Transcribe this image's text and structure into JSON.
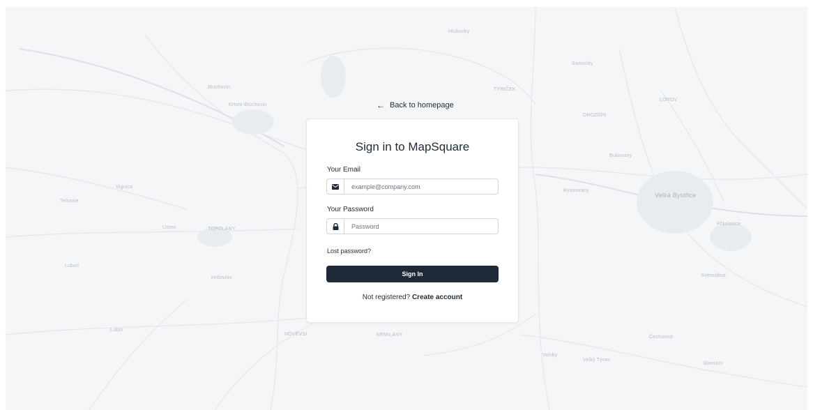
{
  "back_link": {
    "arrow": "←",
    "label": "Back to homepage"
  },
  "card": {
    "title": "Sign in to MapSquare",
    "email": {
      "label": "Your Email",
      "placeholder": "example@company.com",
      "value": ""
    },
    "password": {
      "label": "Your Password",
      "placeholder": "Password",
      "value": ""
    },
    "lost_password": "Lost password?",
    "sign_in_button": "Sign In",
    "register_prompt": "Not registered?",
    "create_account": "Create account"
  },
  "map_labels": [
    "Bluchovin",
    "Krtom-Bluchovin",
    "Vignica",
    "Telsnice",
    "Usten",
    "TOPOLANY",
    "Hrdovitin",
    "Lubolí",
    "Lubín",
    "NOVÉVSI",
    "NEMILANY",
    "TYRIČEK",
    "Hlubocky",
    "Samotíky",
    "DROZDIN",
    "Bukovany",
    "Bystrovany",
    "Velká Bystřice",
    "LOROV",
    "Přáslavice",
    "Svésedlice",
    "Velký Týnec",
    "Čechovice",
    "Slavonín",
    "Valsky"
  ],
  "colors": {
    "primary": "#1f2937",
    "border": "#d1d5db",
    "map_bg": "#f5f6f8"
  }
}
